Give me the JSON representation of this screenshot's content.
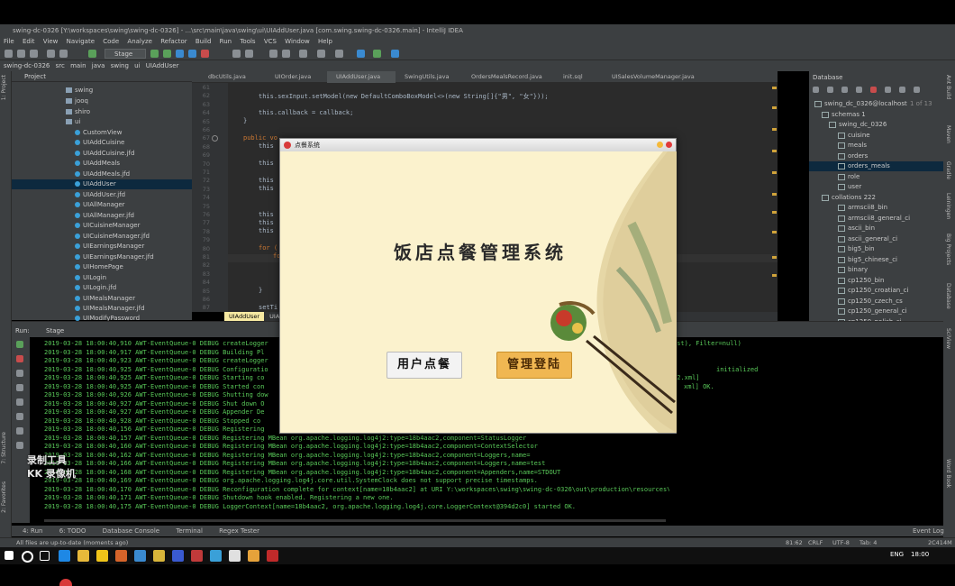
{
  "window": {
    "title": "swing-dc-0326 [Y:\\workspaces\\swing\\swing-dc-0326] - ...\\src\\main\\java\\swing\\ui\\UIAddUser.java [com.swing.swing-dc-0326.main] - IntelliJ IDEA"
  },
  "menu": [
    "File",
    "Edit",
    "View",
    "Navigate",
    "Code",
    "Analyze",
    "Refactor",
    "Build",
    "Run",
    "Tools",
    "VCS",
    "Window",
    "Help"
  ],
  "toolbar": {
    "run_config": "Stage"
  },
  "nav": {
    "crumbs": [
      "swing-dc-0326",
      "src",
      "main",
      "java",
      "swing",
      "ui",
      "UIAddUser"
    ]
  },
  "project": {
    "header": "Project",
    "items": [
      {
        "label": "swing",
        "type": "folder"
      },
      {
        "label": "jooq",
        "type": "folder"
      },
      {
        "label": "shiro",
        "type": "folder"
      },
      {
        "label": "ui",
        "type": "folder"
      },
      {
        "label": "CustomView",
        "type": "class"
      },
      {
        "label": "UIAddCuisine",
        "type": "class"
      },
      {
        "label": "UIAddCuisine.jfd",
        "type": "form"
      },
      {
        "label": "UIAddMeals",
        "type": "class"
      },
      {
        "label": "UIAddMeals.jfd",
        "type": "form"
      },
      {
        "label": "UIAddUser",
        "type": "class",
        "selected": true
      },
      {
        "label": "UIAddUser.jfd",
        "type": "form"
      },
      {
        "label": "UIAllManager",
        "type": "class"
      },
      {
        "label": "UIAllManager.jfd",
        "type": "form"
      },
      {
        "label": "UICuisineManager",
        "type": "class"
      },
      {
        "label": "UICuisineManager.jfd",
        "type": "form"
      },
      {
        "label": "UIEarningsManager",
        "type": "class"
      },
      {
        "label": "UIEarningsManager.jfd",
        "type": "form"
      },
      {
        "label": "UIHomePage",
        "type": "class"
      },
      {
        "label": "UILogin",
        "type": "class"
      },
      {
        "label": "UILogin.jfd",
        "type": "form"
      },
      {
        "label": "UIMealsManager",
        "type": "class"
      },
      {
        "label": "UIMealsManager.jfd",
        "type": "form"
      },
      {
        "label": "UIModifyPassword",
        "type": "class"
      }
    ]
  },
  "tabs": [
    "dbcUtils.java",
    "UIOrder.java",
    "UIAddUser.java",
    "SwingUtils.java",
    "OrdersMealsRecord.java",
    "init.sql",
    "UISalesVolumeManager.java"
  ],
  "editor": {
    "line_numbers": [
      "61",
      "62",
      "63",
      "64",
      "65",
      "66",
      "67",
      "68",
      "69",
      "70",
      "71",
      "72",
      "73",
      "74",
      "75",
      "76",
      "77",
      "78",
      "79",
      "80",
      "81",
      "82",
      "83",
      "84",
      "85",
      "86",
      "87"
    ],
    "line1": "this.sexInput.setModel(new DefaultComboBoxModel<>(new String[]{\"男\", \"女\"}));",
    "line2": "this.callback = callback;",
    "line3": "}",
    "line4": "public vo",
    "line5": "this",
    "line6": "this",
    "line7": "this",
    "line8": "this",
    "line9": "this",
    "line10": "this",
    "line11": "this",
    "line12": "for (",
    "line13": "fo",
    "line14": "}",
    "line15": "setTi",
    "breadcrumb": "UIAddUser",
    "breadcrumb2": "UIA"
  },
  "database": {
    "header": "Database",
    "connection": "swing_dc_0326@localhost",
    "count": "1 of 13",
    "items": [
      {
        "label": "schemas 1",
        "level": 1
      },
      {
        "label": "swing_dc_0326",
        "level": 2
      },
      {
        "label": "cuisine",
        "level": 3
      },
      {
        "label": "meals",
        "level": 3
      },
      {
        "label": "orders",
        "level": 3
      },
      {
        "label": "orders_meals",
        "level": 3,
        "selected": true
      },
      {
        "label": "role",
        "level": 3
      },
      {
        "label": "user",
        "level": 3
      },
      {
        "label": "collations 222",
        "level": 1
      },
      {
        "label": "armscii8_bin",
        "level": 2
      },
      {
        "label": "armscii8_general_ci",
        "level": 2
      },
      {
        "label": "ascii_bin",
        "level": 2
      },
      {
        "label": "ascii_general_ci",
        "level": 2
      },
      {
        "label": "big5_bin",
        "level": 2
      },
      {
        "label": "big5_chinese_ci",
        "level": 2
      },
      {
        "label": "binary",
        "level": 2
      },
      {
        "label": "cp1250_bin",
        "level": 2
      },
      {
        "label": "cp1250_croatian_ci",
        "level": 2
      },
      {
        "label": "cp1250_czech_cs",
        "level": 2
      },
      {
        "label": "cp1250_general_ci",
        "level": 2
      },
      {
        "label": "cp1250_polish_ci",
        "level": 2
      }
    ]
  },
  "run": {
    "label": "Run:",
    "config": "Stage",
    "logs": [
      "2019-03-28 18:00:40,910 AWT-EventQueue-0 DEBUG createLogger",
      "2019-03-28 18:00:40,917 AWT-EventQueue-0 DEBUG Building Pl",
      "2019-03-28 18:00:40,923 AWT-EventQueue-0 DEBUG createLogger",
      "2019-03-28 18:00:40,925 AWT-EventQueue-0 DEBUG Configuratio",
      "2019-03-28 18:00:40,925 AWT-EventQueue-0 DEBUG Starting co",
      "2019-03-28 18:00:40,925 AWT-EventQueue-0 DEBUG Started con",
      "2019-03-28 18:00:40,926 AWT-EventQueue-0 DEBUG Shutting dow",
      "2019-03-28 18:00:40,927 AWT-EventQueue-0 DEBUG Shut down O",
      "2019-03-28 18:00:40,927 AWT-EventQueue-0 DEBUG Appender De",
      "2019-03-28 18:00:40,928 AWT-EventQueue-0 DEBUG Stopped co",
      "2019-03-28 18:00:40,156 AWT-EventQueue-0 DEBUG Registering",
      "2019-03-28 18:00:40,157 AWT-EventQueue-0 DEBUG Registering MBean org.apache.logging.log4j2:type=18b4aac2,component=StatusLogger",
      "2019-03-28 18:00:40,160 AWT-EventQueue-0 DEBUG Registering MBean org.apache.logging.log4j2:type=18b4aac2,component=ContextSelector",
      "2019-03-28 18:00:40,162 AWT-EventQueue-0 DEBUG Registering MBean org.apache.logging.log4j2:type=18b4aac2,component=Loggers,name=",
      "2019-03-28 18:00:40,166 AWT-EventQueue-0 DEBUG Registering MBean org.apache.logging.log4j2:type=18b4aac2,component=Loggers,name=test",
      "2019-03-28 18:00:40,168 AWT-EventQueue-0 DEBUG Registering MBean org.apache.logging.log4j2:type=18b4aac2,component=Appenders,name=STDOUT",
      "2019-03-28 18:00:40,169 AWT-EventQueue-0 DEBUG org.apache.logging.log4j.core.util.SystemClock does not support precise timestamps.",
      "2019-03-28 18:00:40,170 AWT-EventQueue-0 DEBUG Reconfiguration complete for context[name=18b4aac2] at URI Y:\\workspaces\\swing\\swing-dc-0326\\out\\production\\resources\\log4j2.xml (org.apache.logging.log4j.core.LoggerContext@394d",
      "2019-03-28 18:00:40,171 AWT-EventQueue-0 DEBUG Shutdown hook enabled. Registering a new one.",
      "2019-03-28 18:00:40,175 AWT-EventQueue-0 DEBUG LoggerContext[name=18b4aac2, org.apache.logging.log4j.core.LoggerContext@394d2c0] started OK."
    ],
    "right_logs": [
      "",
      "",
      "vst), Filter=null)",
      "",
      "initialized",
      "j2.xml]",
      "xml] OK."
    ]
  },
  "bottom_tabs": [
    "4: Run",
    "6: TODO",
    "Database Console",
    "Terminal",
    "Regex Tester"
  ],
  "event_log": "Event Log",
  "status": {
    "message": "All files are up-to-date (moments ago)",
    "position": "81:62",
    "line_sep": "CRLF",
    "encoding": "UTF-8",
    "indent": "Tab: 4",
    "memory": "2C414M"
  },
  "taskbar": {
    "lang": "ENG",
    "time": "18:00"
  },
  "dialog": {
    "title": "点餐系统",
    "heading": "饭店点餐管理系统",
    "user_button": "用户点餐",
    "admin_button": "管理登陆"
  },
  "watermark": {
    "line1": "录制工具",
    "line2": "KK 录像机"
  },
  "side_labels": {
    "left": [
      "1: Project",
      "7: Structure",
      "2: Favorites"
    ],
    "right": [
      "Ant Build",
      "Maven",
      "Gradle",
      "Leiningen",
      "Big Projects",
      "Database",
      "SciView",
      "Word Book"
    ]
  },
  "colors": {
    "accent": "#0d293e",
    "console_text": "#59c959",
    "dialog_bg": "#fbf2cd",
    "admin_button": "#f0b752"
  }
}
